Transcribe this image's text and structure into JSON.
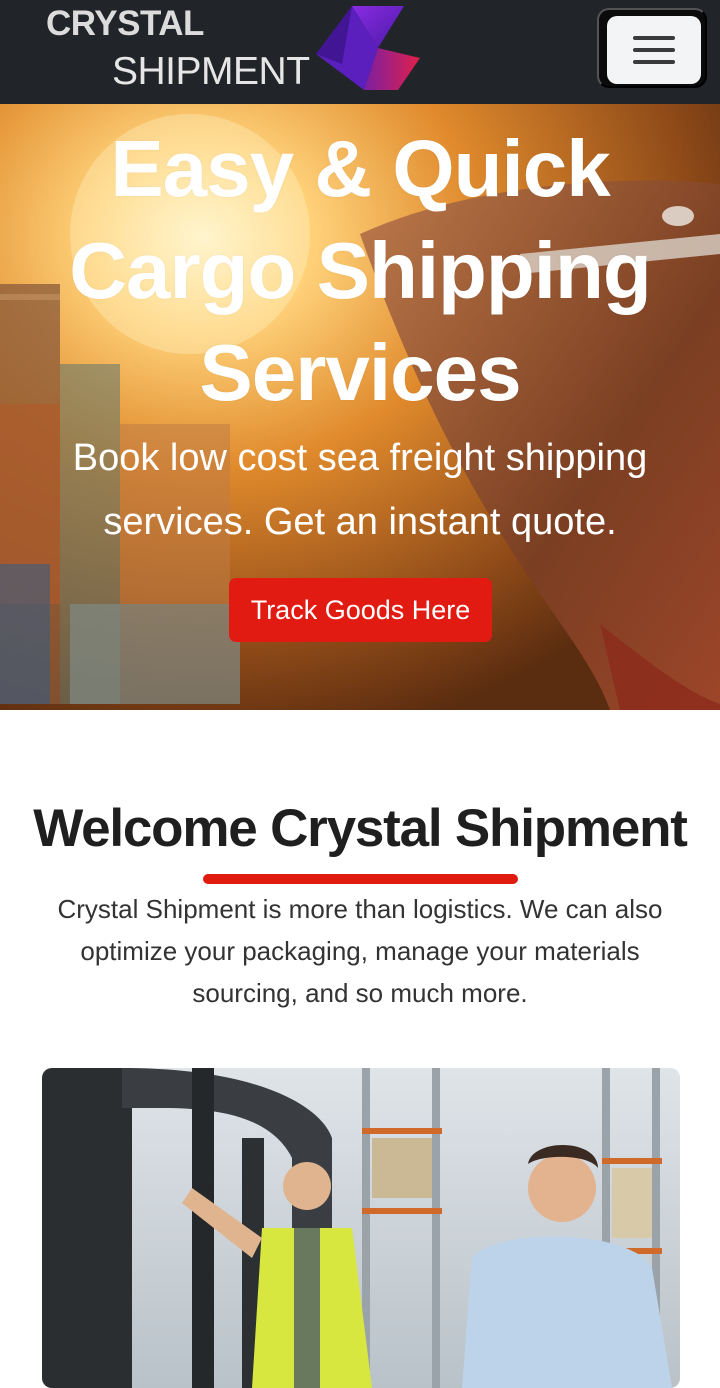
{
  "brand": {
    "name_top": "CRYSTAL",
    "name_bottom": "SHIPMENT",
    "logo_icon": "geometric-purple-red-mark"
  },
  "nav": {
    "menu_icon": "hamburger-icon"
  },
  "hero": {
    "title": "Easy & Quick Cargo Shipping Services",
    "subtitle": "Book low cost sea freight shipping services. Get an instant quote.",
    "button_label": "Track Goods Here"
  },
  "welcome": {
    "title": "Welcome Crystal Shipment",
    "text": "Crystal Shipment is more than logistics. We can also optimize your packaging, manage your materials sourcing, and so much more."
  },
  "colors": {
    "navbar_bg": "#212529",
    "accent_red": "#e21b12",
    "logo_purple": "#6a22c8",
    "heading_text": "#1f1f1f",
    "body_text": "#333333"
  }
}
